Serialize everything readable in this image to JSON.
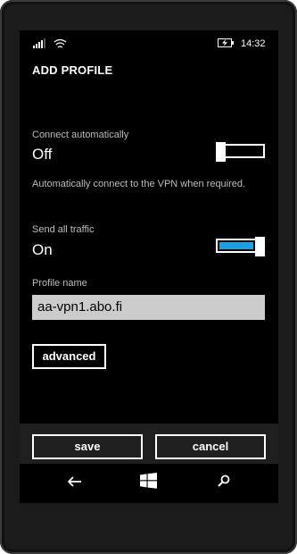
{
  "status_bar": {
    "time": "14:32",
    "icons": [
      "signal-icon",
      "wifi-icon",
      "battery-charging-icon"
    ]
  },
  "page": {
    "title": "ADD PROFILE"
  },
  "settings": [
    {
      "label": "Connect automatically",
      "value": "Off",
      "state": false,
      "description": "Automatically connect to the VPN when required."
    },
    {
      "label": "Send all traffic",
      "value": "On",
      "state": true
    }
  ],
  "profile": {
    "label": "Profile name",
    "value": "aa-vpn1.abo.fi"
  },
  "buttons": {
    "advanced": "advanced",
    "save": "save",
    "cancel": "cancel"
  },
  "colors": {
    "accent": "#1ba1e2",
    "background": "#000000",
    "input_bg": "#cccccc"
  },
  "navigation": {
    "icons": [
      "back-icon",
      "windows-start-icon",
      "search-icon"
    ]
  }
}
